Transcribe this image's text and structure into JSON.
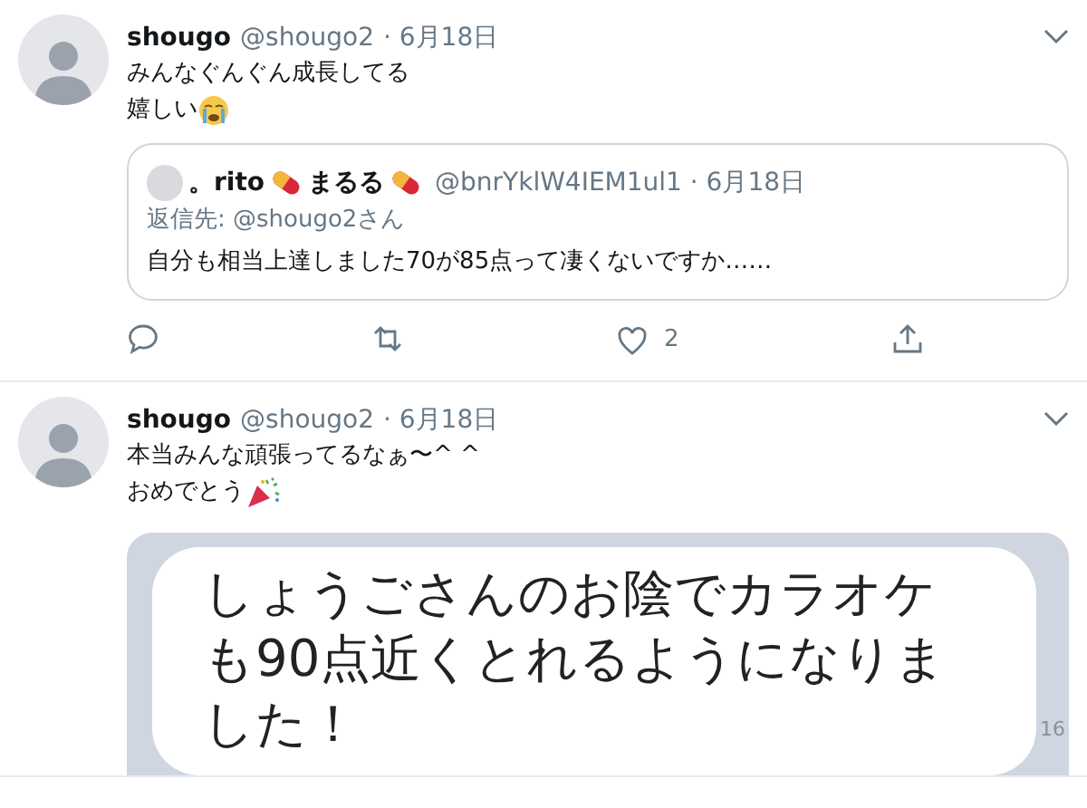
{
  "tweets": [
    {
      "name": "shougo",
      "handle": "@shougo2",
      "date": "· 6月18日",
      "lines": [
        {
          "text": "みんなぐんぐん成長してる"
        },
        {
          "text": "嬉しい",
          "kind": "crying"
        }
      ],
      "quote": {
        "name": "。rito",
        "name_mid": "まるる",
        "handle": "@bnrYklW4IEM1ul1 · 6月18日",
        "reply_to": "返信先: @shougo2さん",
        "text": "自分も相当上達しました70が85点って凄くないですか……"
      },
      "actions": {
        "like_count": "2"
      }
    },
    {
      "name": "shougo",
      "handle": "@shougo2",
      "date": "· 6月18日",
      "lines": [
        {
          "text": "本当みんな頑張ってるなぁ〜^ ^"
        },
        {
          "text": "おめでとう",
          "kind": "party"
        }
      ],
      "image": {
        "lines": [
          "しょうごさんのお陰でカラオケ",
          "も90点近くとれるようになりま",
          "した！"
        ],
        "time": "16"
      }
    }
  ]
}
